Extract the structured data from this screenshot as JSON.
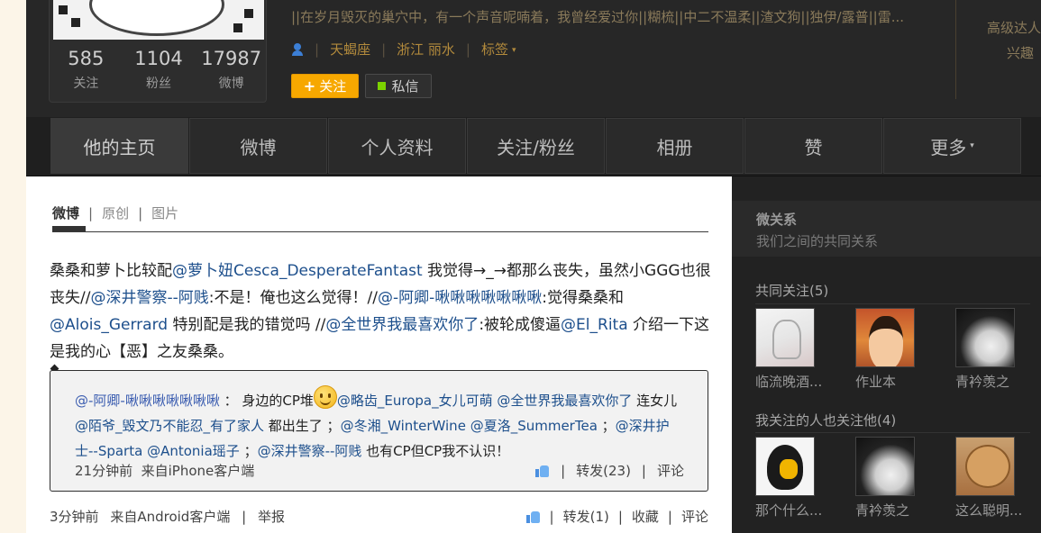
{
  "profile": {
    "counts": [
      {
        "num": "585",
        "label": "关注"
      },
      {
        "num": "1104",
        "label": "粉丝"
      },
      {
        "num": "17987",
        "label": "微博"
      }
    ],
    "intro": "||在岁月毁灭的巢穴中，有一个声音呢喃着，我曾经爱过你||糊梳||中二不温柔||渣文狗||独伊/露普||雷...",
    "zodiac": "天蝎座",
    "location": "浙江 丽水",
    "tags_label": "标签",
    "follow_label": "关注",
    "message_label": "私信",
    "badge_line1": "高级达人",
    "badge_line2": "兴趣"
  },
  "nav": {
    "tabs": [
      "他的主页",
      "微博",
      "个人资料",
      "关注/粉丝",
      "相册",
      "赞",
      "更多"
    ]
  },
  "feed": {
    "subtabs": [
      "微博",
      "原创",
      "图片"
    ],
    "post": {
      "segments": [
        {
          "t": "桑桑和萝卜比较配",
          "m": false
        },
        {
          "t": "@萝卜妞Cesca_DesperateFantast",
          "m": true
        },
        {
          "t": " 我觉得→_→都那么丧失，虽然小GGG也很丧失//",
          "m": false
        },
        {
          "t": "@深井警察--阿贱",
          "m": true
        },
        {
          "t": ":不是！俺也这么觉得！//",
          "m": false
        },
        {
          "t": "@-阿卿-啾啾啾啾啾啾啾",
          "m": true
        },
        {
          "t": ":觉得桑桑和",
          "m": false
        },
        {
          "t": "@Alois_Gerrard",
          "m": true
        },
        {
          "t": " 特别配是我的错觉吗 //",
          "m": false
        },
        {
          "t": "@全世界我最喜欢你了",
          "m": true
        },
        {
          "t": ":被轮成傻逼",
          "m": false
        },
        {
          "t": "@El_Rita",
          "m": true
        },
        {
          "t": " 介绍一下这是我的心【恶】之友桑桑。",
          "m": false
        }
      ],
      "time": "3分钟前",
      "source": "来自Android客户端",
      "report": "举报",
      "repost": "转发(1)",
      "favorite": "收藏",
      "comment": "评论"
    },
    "quote": {
      "author": "@-阿卿-啾啾啾啾啾啾啾",
      "colon": " ： 身边的CP堆",
      "segments": [
        {
          "t": "@略齿_Europa_女儿可萌",
          "m": true
        },
        {
          "t": " ",
          "m": false
        },
        {
          "t": "@全世界我最喜欢你了",
          "m": true
        },
        {
          "t": " 连女儿",
          "m": false
        },
        {
          "t": "@陌爷_毁文乃不能忍_有了家人",
          "m": true
        },
        {
          "t": " 都出生了 ；",
          "m": false
        },
        {
          "t": "@冬湘_WinterWine",
          "m": true
        },
        {
          "t": " ",
          "m": false
        },
        {
          "t": "@夏洛_SummerTea",
          "m": true
        },
        {
          "t": " ；",
          "m": false
        },
        {
          "t": "@深井护士--Sparta",
          "m": true
        },
        {
          "t": " ",
          "m": false
        },
        {
          "t": "@Antonia瑶子",
          "m": true
        },
        {
          "t": " ；",
          "m": false
        },
        {
          "t": "@深井警察--阿贱",
          "m": true
        },
        {
          "t": " 也有CP但CP我不认识！",
          "m": false
        }
      ],
      "time": "21分钟前",
      "source": "来自iPhone客户端",
      "repost": "转发(23)",
      "comment": "评论"
    }
  },
  "sidebar": {
    "title": "微关系",
    "subtitle": "我们之间的共同关系",
    "common_follow": {
      "label": "共同关注",
      "count": "(5)"
    },
    "also_follow": {
      "label": "我关注的人也关注他",
      "count": "(4)"
    },
    "users_common": [
      {
        "name": "临流晚酒...",
        "img": "sketch"
      },
      {
        "name": "作业本",
        "img": "kid"
      },
      {
        "name": "青衿羡之",
        "img": "paw"
      }
    ],
    "users_also": [
      {
        "name": "那个什么...",
        "img": "bird"
      },
      {
        "name": "青衿羡之",
        "img": "paw"
      },
      {
        "name": "这么聪明...",
        "img": "bear"
      }
    ]
  }
}
